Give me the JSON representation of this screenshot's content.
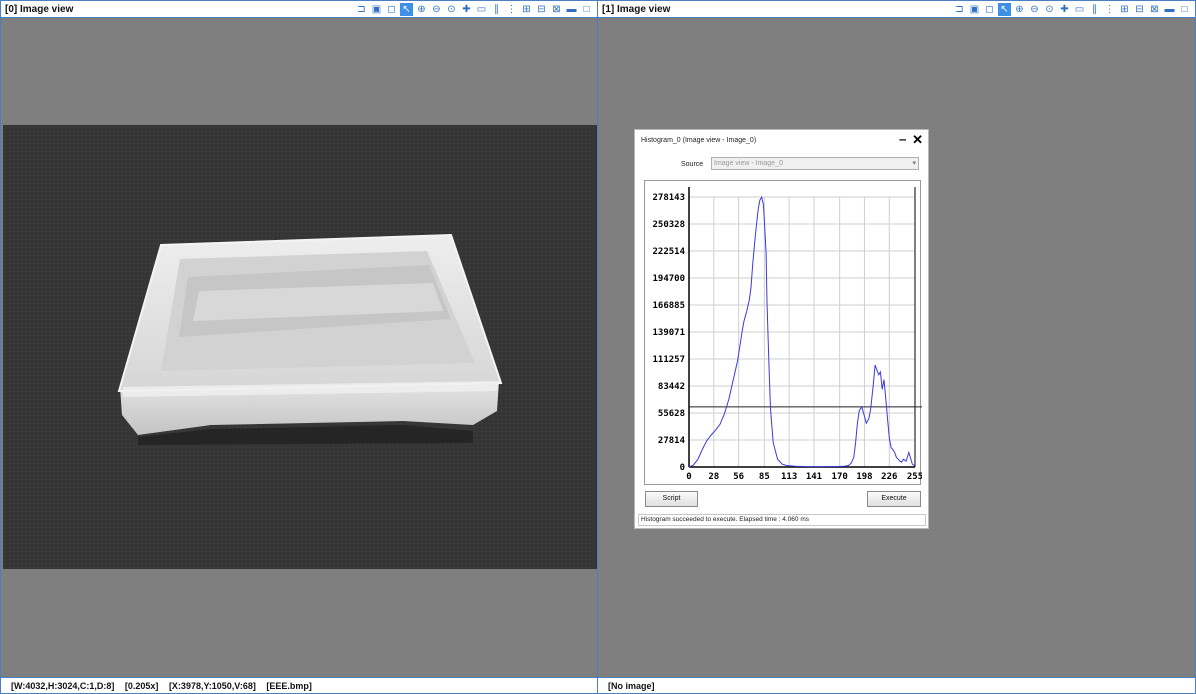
{
  "pane0": {
    "title": "[0] Image view",
    "status": [
      "[W:4032,H:3024,C:1,D:8]",
      "[0.205x]",
      "[X:3978,Y:1050,V:68]",
      "[EEE.bmp]"
    ]
  },
  "pane1": {
    "title": "[1] Image view",
    "status": [
      "[No image]"
    ]
  },
  "toolbar_icons": [
    "folder-open-icon",
    "save-icon",
    "clear-icon",
    "pointer-icon",
    "zoom-fit-icon",
    "zoom-out-icon",
    "zoom-in-icon",
    "crosshair-icon",
    "ruler-icon",
    "measure-icon",
    "grid-icon",
    "layout-1-icon",
    "layout-2-icon",
    "layout-3-icon",
    "layout-4-icon",
    "fullscreen-icon"
  ],
  "histogram_dialog": {
    "title": "Histogram_0 (Image view - Image_0)",
    "source_label": "Source",
    "source_value": "Image view - Image_0",
    "script_button": "Script",
    "execute_button": "Execute",
    "status": "Histogram succeeded to execute. Elapsed time : 4.060 ms"
  },
  "chart_data": {
    "type": "line",
    "x_ticks": [
      "0",
      "28",
      "56",
      "85",
      "113",
      "141",
      "170",
      "198",
      "226",
      "255"
    ],
    "y_ticks": [
      "0",
      "27814",
      "55628",
      "83442",
      "111257",
      "139071",
      "166885",
      "194700",
      "222514",
      "250328",
      "278143"
    ],
    "xlim": [
      0,
      255
    ],
    "ylim": [
      0,
      278143
    ],
    "grid": true,
    "threshold_line": 62000,
    "line_color": "#3a3ae0",
    "x": [
      0,
      5,
      10,
      15,
      20,
      25,
      30,
      35,
      40,
      45,
      50,
      55,
      60,
      62,
      65,
      68,
      70,
      72,
      75,
      78,
      80,
      82,
      84,
      85,
      87,
      88,
      90,
      92,
      95,
      100,
      105,
      110,
      120,
      130,
      140,
      150,
      160,
      170,
      175,
      180,
      183,
      186,
      188,
      190,
      192,
      195,
      198,
      200,
      203,
      205,
      208,
      210,
      212,
      214,
      216,
      218,
      220,
      222,
      224,
      226,
      228,
      230,
      232,
      234,
      236,
      238,
      240,
      242,
      245,
      248,
      250,
      252,
      255
    ],
    "y": [
      0,
      2000,
      8000,
      18000,
      27000,
      33000,
      38000,
      44000,
      55000,
      70000,
      90000,
      110000,
      140000,
      150000,
      160000,
      172000,
      185000,
      210000,
      240000,
      265000,
      275000,
      278000,
      270000,
      255000,
      220000,
      170000,
      110000,
      60000,
      25000,
      8000,
      3000,
      1500,
      800,
      500,
      400,
      400,
      500,
      600,
      800,
      1500,
      4000,
      10000,
      25000,
      45000,
      58000,
      62000,
      52000,
      45000,
      50000,
      60000,
      85000,
      105000,
      100000,
      95000,
      98000,
      80000,
      90000,
      70000,
      50000,
      30000,
      20000,
      18000,
      15000,
      10000,
      8000,
      6000,
      5000,
      8000,
      6000,
      15000,
      9000,
      3000,
      1000
    ]
  }
}
